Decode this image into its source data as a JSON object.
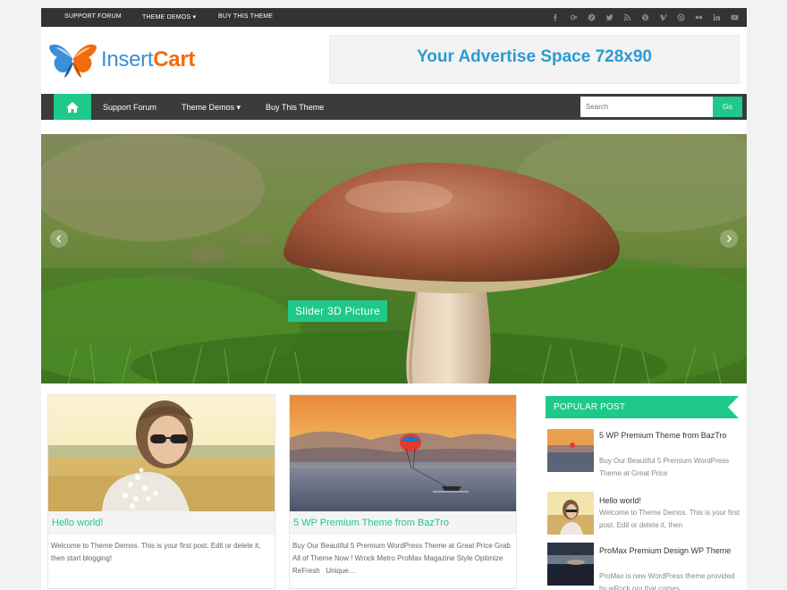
{
  "topbar": {
    "links": [
      "SUPPORT FORUM",
      "THEME DEMOS ▾",
      "BUY THIS THEME"
    ],
    "social_icons": [
      "facebook-icon",
      "google-plus-icon",
      "pinterest-icon",
      "twitter-icon",
      "rss-icon",
      "skype-icon",
      "vimeo-icon",
      "dribbble-icon",
      "flickr-icon",
      "linkedin-icon",
      "youtube-icon"
    ]
  },
  "header": {
    "logo_part1": "Insert",
    "logo_part2": "Cart",
    "ad_text": "Your Advertise Space 728x90"
  },
  "nav": {
    "home_icon": "home-icon",
    "items": [
      "Support Forum",
      "Theme Demos ▾",
      "Buy This Theme"
    ],
    "search_placeholder": "Search",
    "go_label": "Go"
  },
  "slider": {
    "caption": "Slider 3D Picture"
  },
  "posts": [
    {
      "title": "Hello world!",
      "excerpt": "Welcome to Theme Demos. This is your first post. Edit or delete it, then start blogging!"
    },
    {
      "title": "5 WP Premium Theme from BazTro",
      "excerpt": "Buy Our Beautiful 5 Premium WordPress Theme at Great Price Grab All of Theme Now ! Wrock Metro ProMax Magazine Style Optimize ReFresh   Unique…"
    }
  ],
  "sidebar": {
    "heading": "POPULAR POST",
    "items": [
      {
        "title": "5 WP Premium Theme from BazTro",
        "excerpt": "Buy Our Beautiful 5 Premium WordPress Theme at Great Price"
      },
      {
        "title": "Hello world!",
        "excerpt": "Welcome to Theme Demos. This is your first post. Edit or delete it, then"
      },
      {
        "title": "ProMax Premium Design WP Theme",
        "excerpt": "ProMax is new WordPress theme provided by wRock.org that comes"
      }
    ]
  },
  "colors": {
    "accent": "#1fc98a",
    "topbar": "#333333",
    "navbar": "#3b3b3b",
    "ad_text": "#2a9bd3",
    "logo_blue": "#3a8fd6",
    "logo_orange": "#f26b0f"
  }
}
